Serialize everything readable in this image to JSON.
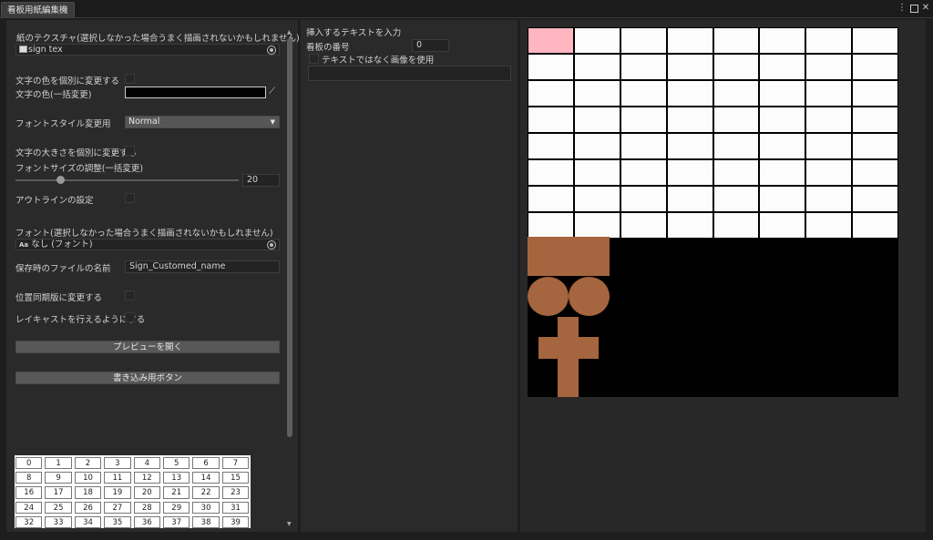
{
  "window": {
    "tab_title": "看板用紙編集機",
    "menu_icon": "more-vert-icon",
    "maximize_icon": "maximize-icon",
    "close_icon": "close-icon"
  },
  "left": {
    "paper_texture_label": "紙のテクスチャ(選択しなかった場合うまく描画されないかもしれません)",
    "paper_texture_value": "sign tex",
    "char_color_individual_label": "文字の色を個別に変更する",
    "char_color_bulk_label": "文字の色(一括変更)",
    "char_color_value": "#000000",
    "eyedropper_icon": "eyedropper-icon",
    "font_style_label": "フォントスタイル変更用",
    "font_style_value": "Normal",
    "char_size_individual_label": "文字の大きさを個別に変更する",
    "font_size_bulk_label": "フォントサイズの調整(一括変更)",
    "font_size_value": "20",
    "font_size_slider_fraction": 0.2,
    "outline_label": "アウトラインの設定",
    "font_label": "フォント(選択しなかった場合うまく描画されないかもしれません)",
    "font_value_prefix": "Aa",
    "font_value": "なし (フォント)",
    "save_name_label": "保存時のファイルの名前",
    "save_name_value": "Sign_Customed_name",
    "position_sync_label": "位置同期版に変更する",
    "raycast_label": "レイキャストを行えるようにする",
    "open_preview_button": "プレビューを開く",
    "write_button": "書き込み用ボタン",
    "grid_numbers": [
      "0",
      "1",
      "2",
      "3",
      "4",
      "5",
      "6",
      "7",
      "8",
      "9",
      "10",
      "11",
      "12",
      "13",
      "14",
      "15",
      "16",
      "17",
      "18",
      "19",
      "20",
      "21",
      "22",
      "23",
      "24",
      "25",
      "26",
      "27",
      "28",
      "29",
      "30",
      "31",
      "32",
      "33",
      "34",
      "35",
      "36",
      "37",
      "38",
      "39"
    ]
  },
  "middle": {
    "insert_text_label": "挿入するテキストを入力",
    "sign_number_label": "看板の番号",
    "sign_number_value": "0",
    "use_image_label": "テキストではなく画像を使用"
  },
  "colors": {
    "accent_selected_cell": "#ffb6c1",
    "shape_brown": "#a5653e",
    "preview_background": "#000000",
    "cell_white": "#fcfcfc"
  }
}
